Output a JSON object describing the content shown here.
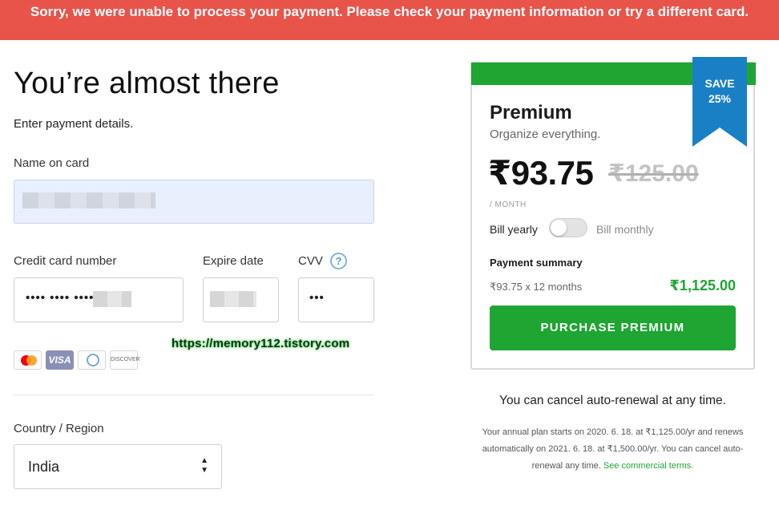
{
  "error_banner": "Sorry, we were unable to process your payment. Please check your payment information or try a different card.",
  "form": {
    "title": "You’re almost there",
    "subtitle": "Enter payment details.",
    "name_label": "Name on card",
    "card_number_label": "Credit card number",
    "card_number_masked": "•••• •••• ••••",
    "expire_label": "Expire date",
    "cvv_label": "CVV",
    "cvv_help_icon": "?",
    "cvv_value": "•••",
    "card_logos": [
      "mastercard-icon",
      "visa-icon",
      "diners-icon",
      "discover-icon"
    ],
    "visa_text": "VISA",
    "discover_text": "DISCOVER",
    "country_label": "Country / Region",
    "country_value": "India",
    "select_arrows": "▲▼"
  },
  "watermark": "https://memory112.tistory.com",
  "plan": {
    "ribbon_line1": "SAVE",
    "ribbon_line2": "25%",
    "name": "Premium",
    "tagline": "Organize everything.",
    "price": "₹93.75",
    "old_price": "₹125.00",
    "per": "/ MONTH",
    "bill_yearly": "Bill yearly",
    "bill_monthly": "Bill monthly",
    "billing_toggle_on": false,
    "summary_title": "Payment summary",
    "summary_calc": "₹93.75 x 12 months",
    "summary_total": "₹1,125.00",
    "purchase_button": "PURCHASE PREMIUM"
  },
  "footer": {
    "cancel_note": "You can cancel auto-renewal at any time.",
    "fineprint": "Your annual plan starts on 2020. 6. 18. at ₹1,125.00/yr and renews automatically on 2021. 6. 18. at ₹1,500.00/yr. You can cancel auto-renewal any time.",
    "terms_link": "See commercial terms."
  },
  "colors": {
    "error_red": "#e8534a",
    "brand_green": "#1ea532",
    "ribbon_blue": "#1a80c6"
  }
}
